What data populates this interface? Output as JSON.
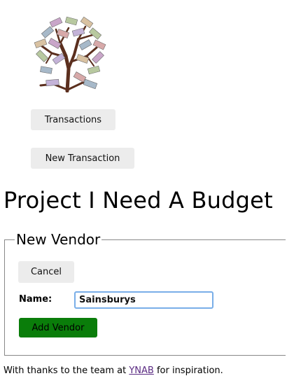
{
  "nav": {
    "transactions_label": "Transactions",
    "new_transaction_label": "New Transaction"
  },
  "page": {
    "title": "Project I Need A Budget"
  },
  "vendor_form": {
    "legend": "New Vendor",
    "cancel_label": "Cancel",
    "name_label": "Name:",
    "name_value": "Sainsburys",
    "add_label": "Add Vendor"
  },
  "footer": {
    "prefix": "With thanks to the team at ",
    "link_text": "YNAB",
    "suffix": " for inspiration."
  },
  "colors": {
    "add_button": "#0a7d0a",
    "nav_button": "#ececec",
    "link": "#5a2a82"
  },
  "icons": {
    "logo": "money-tree-icon"
  }
}
